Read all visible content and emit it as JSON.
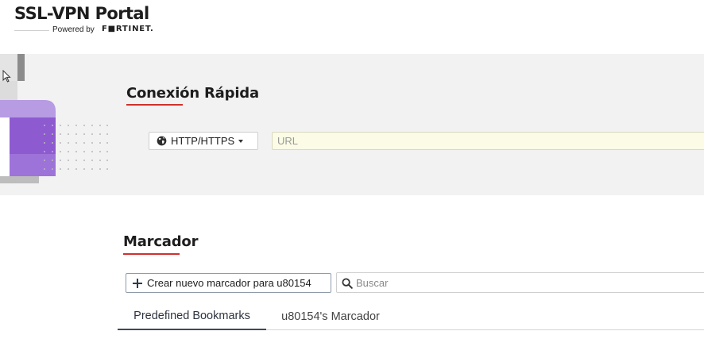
{
  "header": {
    "app_title": "SSL-VPN Portal",
    "powered_by": "Powered by",
    "brand": "F■RTINET."
  },
  "quick_connect": {
    "title": "Conexión Rápida",
    "protocol": "HTTP/HTTPS",
    "url_placeholder": "URL",
    "url_value": ""
  },
  "bookmarks": {
    "title": "Marcador",
    "new_button_label": "Crear nuevo marcador para u80154",
    "search_placeholder": "Buscar",
    "tabs": [
      {
        "label": "Predefined Bookmarks",
        "active": true
      },
      {
        "label": "u80154's Marcador",
        "active": false
      }
    ]
  },
  "colors": {
    "accent_red": "#d0312d",
    "band_background": "#f2f2f2",
    "url_field_background": "#fbfbe6",
    "illustration_purple": "#8e5ad0"
  },
  "icons": [
    "cursor-icon",
    "globe-icon",
    "caret-down-icon",
    "plus-icon",
    "search-icon"
  ]
}
